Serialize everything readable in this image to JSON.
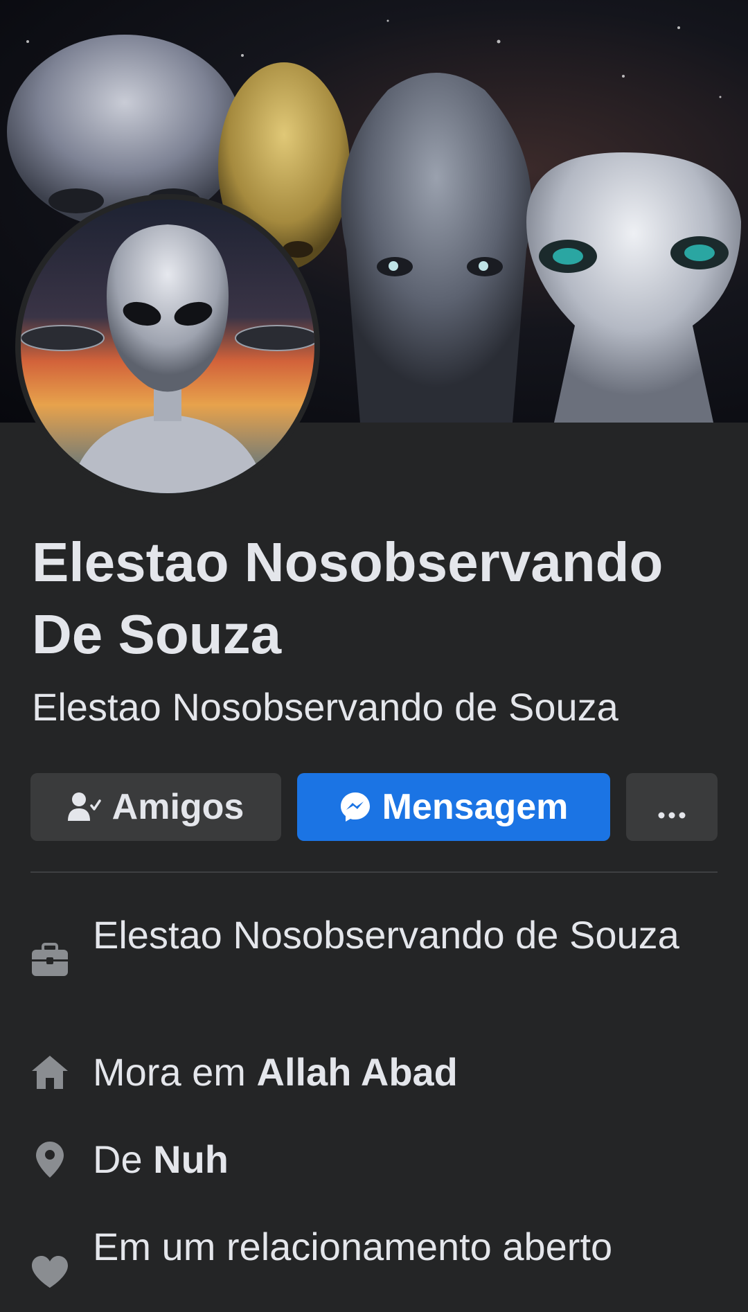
{
  "profile": {
    "name": "Elestao Nosobservando De Souza",
    "alternate_name": "Elestao Nosobservando de Souza"
  },
  "actions": {
    "friends_label": "Amigos",
    "friends_icon": "friends-check-icon",
    "message_label": "Mensagem",
    "message_icon": "messenger-icon",
    "more_icon": "more-dots-icon"
  },
  "intro": {
    "work": {
      "icon": "briefcase-icon",
      "text": "Elestao Nosobservando de Souza"
    },
    "lives": {
      "icon": "home-icon",
      "prefix": "Mora em",
      "place": "Allah Abad"
    },
    "from": {
      "icon": "location-pin-icon",
      "prefix": "De",
      "place": "Nuh"
    },
    "relationship": {
      "icon": "heart-icon",
      "text": "Em um relacionamento aberto"
    }
  },
  "colors": {
    "background": "#242526",
    "button_secondary": "#3a3b3c",
    "button_primary": "#1b74e4",
    "text_primary": "#e4e6eb",
    "icon_gray": "#8a8d91"
  }
}
